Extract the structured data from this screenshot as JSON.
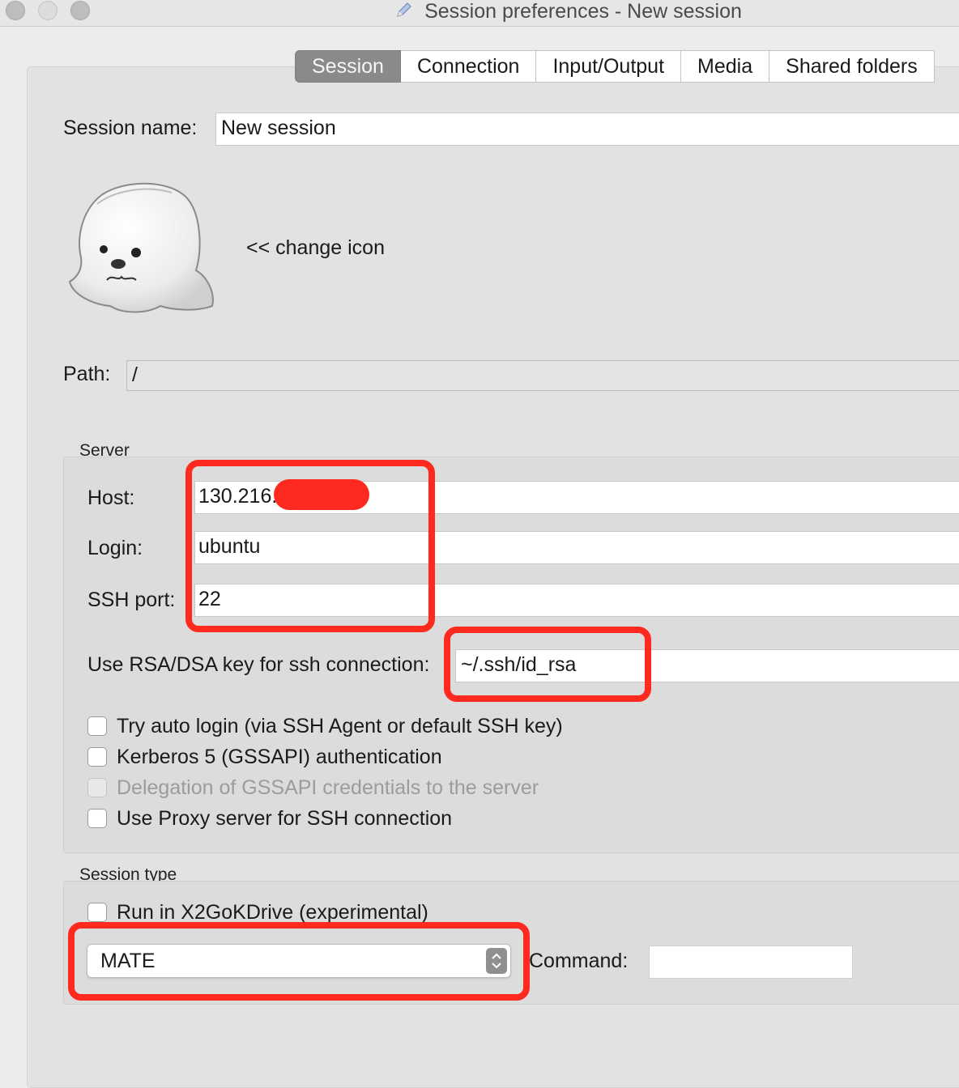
{
  "window": {
    "title": "Session preferences - New session",
    "title_icon": "pencil-icon"
  },
  "tabs": [
    {
      "label": "Session",
      "active": true
    },
    {
      "label": "Connection",
      "active": false
    },
    {
      "label": "Input/Output",
      "active": false
    },
    {
      "label": "Media",
      "active": false
    },
    {
      "label": "Shared folders",
      "active": false
    }
  ],
  "session": {
    "name_label": "Session name:",
    "name_value": "New session",
    "change_icon_label": "<< change icon",
    "icon": "seal-icon",
    "path_label": "Path:",
    "path_value": "/"
  },
  "server": {
    "title": "Server",
    "host_label": "Host:",
    "host_value": "130.216.",
    "login_label": "Login:",
    "login_value": "ubuntu",
    "port_label": "SSH port:",
    "port_value": "22",
    "rsa_label": "Use RSA/DSA key for ssh connection:",
    "rsa_value": "~/.ssh/id_rsa",
    "checkboxes": [
      {
        "label": "Try auto login (via SSH Agent or default SSH key)",
        "checked": false,
        "enabled": true
      },
      {
        "label": "Kerberos 5 (GSSAPI) authentication",
        "checked": false,
        "enabled": true
      },
      {
        "label": "Delegation of GSSAPI credentials to the server",
        "checked": false,
        "enabled": false
      },
      {
        "label": "Use Proxy server for SSH connection",
        "checked": false,
        "enabled": true
      }
    ]
  },
  "session_type": {
    "title": "Session type",
    "kdrive_label": "Run in X2GoKDrive (experimental)",
    "kdrive_checked": false,
    "type_value": "MATE",
    "command_label": "Command:",
    "command_value": ""
  },
  "colors": {
    "annotation_red": "#ff2a1f",
    "active_tab": "#8a8a8a"
  }
}
